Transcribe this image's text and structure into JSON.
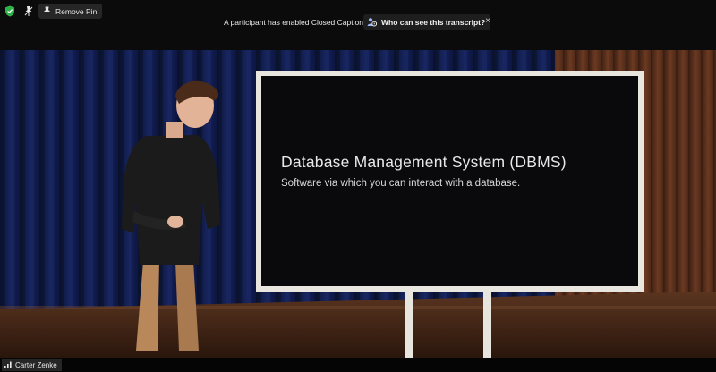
{
  "toolbar": {
    "shield_icon": "shield-check-icon",
    "unpin_icon": "pin-icon",
    "remove_pin_label": "Remove Pin"
  },
  "captions_bar": {
    "notice_text": "A participant has enabled Closed Captioning",
    "transcript_button_label": "Who can see this transcript?",
    "close_symbol": "×"
  },
  "presentation": {
    "board_title": "Database Management System (DBMS)",
    "board_subtitle": "Software via which you can interact with a database."
  },
  "participant": {
    "name": "Carter Zenke",
    "signal_icon": "signal-bars-icon"
  },
  "colors": {
    "curtain": "#0f1a4a",
    "wood_wall": "#5a2e1a",
    "board_frame": "#e9e6df",
    "board_face": "#0a0a0c",
    "accent_shield": "#2db24a"
  }
}
